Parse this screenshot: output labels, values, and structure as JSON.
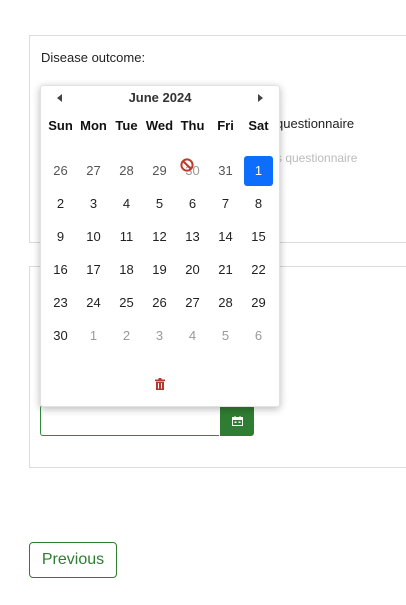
{
  "form": {
    "question_label": "Disease outcome:",
    "option_1_partial": "questionnaire",
    "option_2_partial": "s questionnaire",
    "date_input_value": ""
  },
  "datepicker": {
    "month_title": "June 2024",
    "weekdays": [
      "Sun",
      "Mon",
      "Tue",
      "Wed",
      "Thu",
      "Fri",
      "Sat"
    ],
    "days": [
      {
        "label": "26",
        "state": "other-month"
      },
      {
        "label": "27",
        "state": "other-month"
      },
      {
        "label": "28",
        "state": "other-month"
      },
      {
        "label": "29",
        "state": "other-month"
      },
      {
        "label": "30",
        "state": "disabled-hover"
      },
      {
        "label": "31",
        "state": "other-month"
      },
      {
        "label": "1",
        "state": "selected"
      },
      {
        "label": "2",
        "state": "current"
      },
      {
        "label": "3",
        "state": "current"
      },
      {
        "label": "4",
        "state": "current"
      },
      {
        "label": "5",
        "state": "current"
      },
      {
        "label": "6",
        "state": "current"
      },
      {
        "label": "7",
        "state": "current"
      },
      {
        "label": "8",
        "state": "current"
      },
      {
        "label": "9",
        "state": "current"
      },
      {
        "label": "10",
        "state": "current"
      },
      {
        "label": "11",
        "state": "current"
      },
      {
        "label": "12",
        "state": "current"
      },
      {
        "label": "13",
        "state": "current"
      },
      {
        "label": "14",
        "state": "current"
      },
      {
        "label": "15",
        "state": "current"
      },
      {
        "label": "16",
        "state": "current"
      },
      {
        "label": "17",
        "state": "current"
      },
      {
        "label": "18",
        "state": "current"
      },
      {
        "label": "19",
        "state": "current"
      },
      {
        "label": "20",
        "state": "current"
      },
      {
        "label": "21",
        "state": "current"
      },
      {
        "label": "22",
        "state": "current"
      },
      {
        "label": "23",
        "state": "current"
      },
      {
        "label": "24",
        "state": "current"
      },
      {
        "label": "25",
        "state": "current"
      },
      {
        "label": "26",
        "state": "current"
      },
      {
        "label": "27",
        "state": "current"
      },
      {
        "label": "28",
        "state": "current"
      },
      {
        "label": "29",
        "state": "current"
      },
      {
        "label": "30",
        "state": "current"
      },
      {
        "label": "1",
        "state": "next-month"
      },
      {
        "label": "2",
        "state": "next-month"
      },
      {
        "label": "3",
        "state": "next-month"
      },
      {
        "label": "4",
        "state": "next-month"
      },
      {
        "label": "5",
        "state": "next-month"
      },
      {
        "label": "6",
        "state": "next-month"
      }
    ],
    "icons": {
      "prev": "caret-left-icon",
      "next": "caret-right-icon",
      "clear": "trash-icon",
      "blocked": "no-entry-icon"
    }
  },
  "navigation": {
    "previous_label": "Previous"
  },
  "colors": {
    "accent_green": "#2e7d32",
    "selected_blue": "#0d6efd",
    "danger_red": "#c0392b"
  }
}
